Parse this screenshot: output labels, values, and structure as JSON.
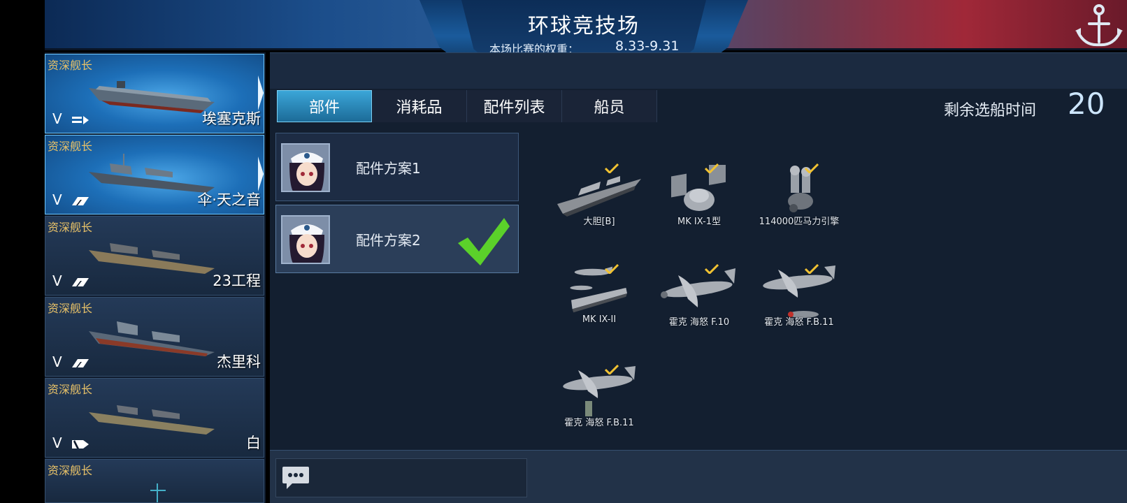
{
  "header": {
    "title": "环球竞技场",
    "subtitle_label": "本场比赛的权重：",
    "weight_range": "8.33-9.31"
  },
  "ships": [
    {
      "rank": "资深舰长",
      "tier": "V",
      "name": "埃塞克斯",
      "active": true
    },
    {
      "rank": "资深舰长",
      "tier": "V",
      "name": "伞·天之音",
      "active": true
    },
    {
      "rank": "资深舰长",
      "tier": "V",
      "name": "23工程",
      "active": false
    },
    {
      "rank": "资深舰长",
      "tier": "V",
      "name": "杰里科",
      "active": false
    },
    {
      "rank": "资深舰长",
      "tier": "V",
      "name": "白",
      "active": false
    },
    {
      "rank": "资深舰长",
      "tier": "",
      "name": "",
      "active": false
    }
  ],
  "tabs": [
    {
      "label": "部件",
      "selected": true
    },
    {
      "label": "消耗品",
      "selected": false
    },
    {
      "label": "配件列表",
      "selected": false
    },
    {
      "label": "船员",
      "selected": false
    }
  ],
  "timer": {
    "label": "剩余选船时间",
    "value": "20"
  },
  "configs": [
    {
      "name": "配件方案1",
      "selected": false
    },
    {
      "name": "配件方案2",
      "selected": true
    }
  ],
  "parts": [
    {
      "label": "大胆[B]",
      "icon": "ship-hull-icon"
    },
    {
      "label": "MK IX-1型",
      "icon": "fire-control-icon"
    },
    {
      "label": "114000匹马力引擎",
      "icon": "engine-icon"
    },
    {
      "label": "MK IX-II",
      "icon": "carrier-plane-icon"
    },
    {
      "label": "霍克 海怒 F.10",
      "icon": "fighter-plane-icon"
    },
    {
      "label": "霍克 海怒 F.B.11",
      "icon": "bomber-plane-icon"
    },
    {
      "label": "霍克 海怒 F.B.11",
      "icon": "bomber-plane-icon"
    }
  ],
  "colors": {
    "accent": "#3ba6d8",
    "rank_gold": "#e7c168",
    "check_green": "#5bd12a",
    "check_yellow": "#f1c232"
  }
}
